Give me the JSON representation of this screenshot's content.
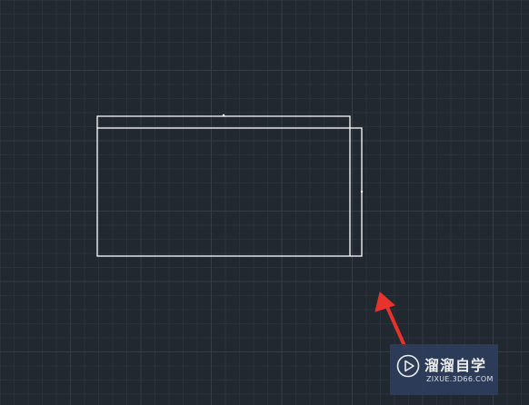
{
  "canvas": {
    "background_color": "#212830",
    "grid_minor_color": "#2a323c",
    "grid_major_color": "#333c47",
    "line_color": "#ffffff"
  },
  "annotation": {
    "arrow_color": "#e8332c",
    "arrow_direction": "up-left"
  },
  "watermark": {
    "logo_icon": "play-logo-icon",
    "title": "溜溜自学",
    "url": "ZIXUE.3D66.COM",
    "background_color": "#2e3d5c"
  }
}
